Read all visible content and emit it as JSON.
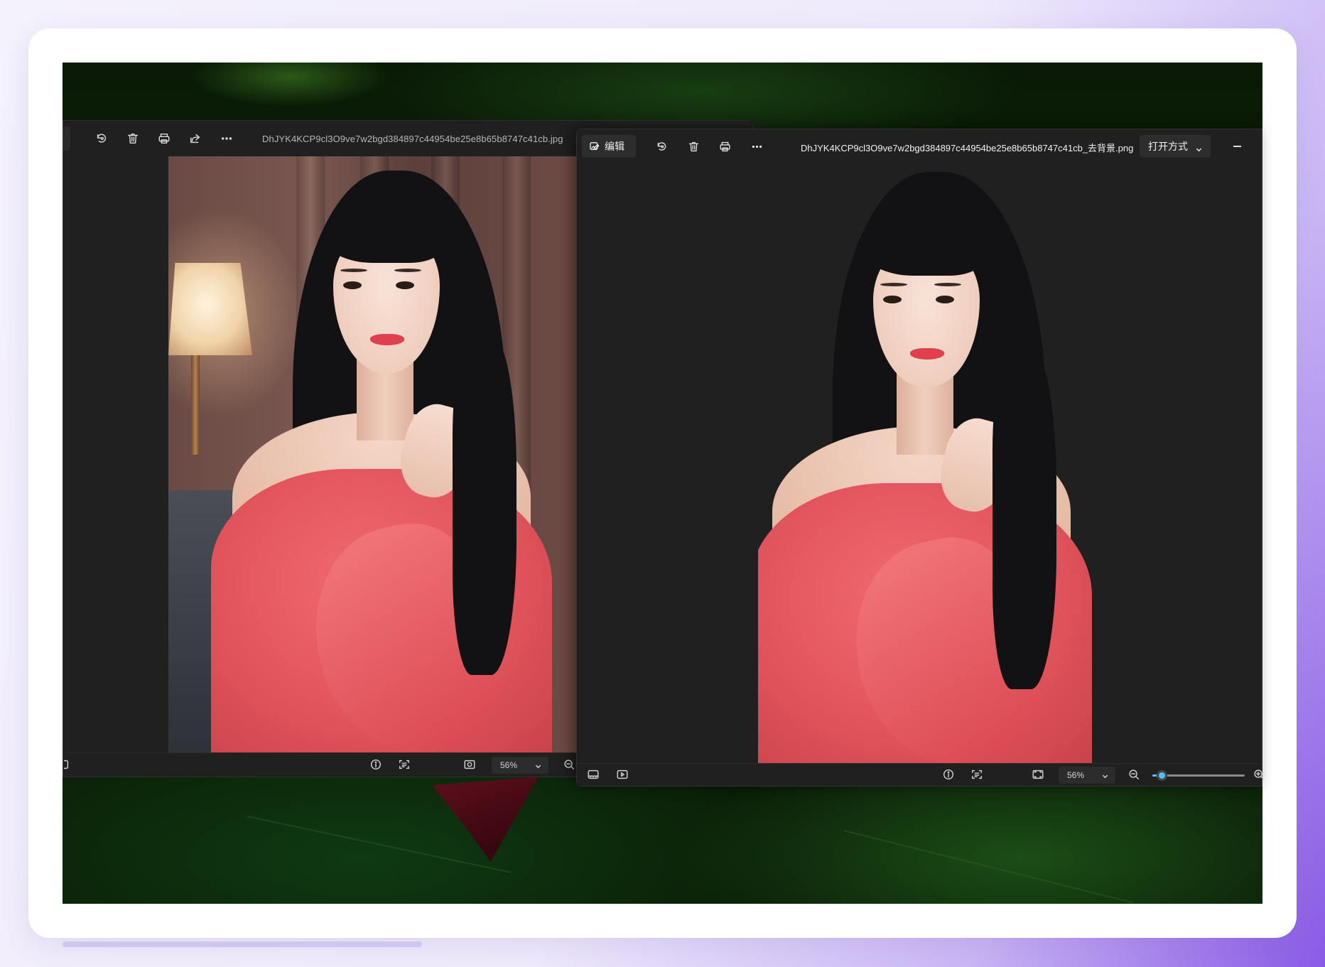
{
  "back_window": {
    "filename": "DhJYK4KCP9cl3O9ve7w2bgd384897c44954be25e8b65b8747c41cb.jpg",
    "toolbar_icons": [
      "rotate-icon",
      "delete-icon",
      "print-icon",
      "share-icon",
      "more-icon"
    ],
    "zoom_label": "56%"
  },
  "front_window": {
    "edit_label": "编辑",
    "filename": "DhJYK4KCP9cl3O9ve7w2bgd384897c44954be25e8b65b8747c41cb_去背景.png",
    "open_with_label": "打开方式",
    "toolbar_icons": [
      "rotate-icon",
      "delete-icon",
      "print-icon",
      "more-icon"
    ],
    "zoom_label": "56%",
    "zoom_slider_position": 0.1
  },
  "colors": {
    "accent": "#4cc2ff",
    "window_bg": "#202020",
    "sweater": "#e2545c"
  }
}
